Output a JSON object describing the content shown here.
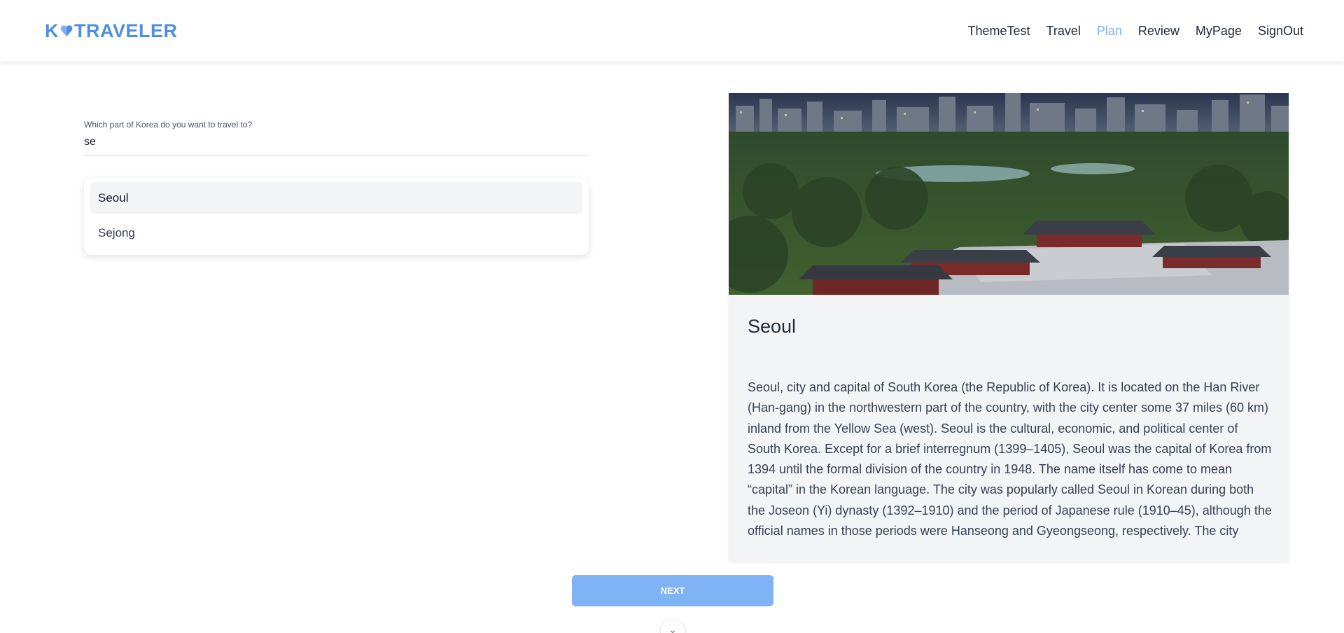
{
  "header": {
    "logo_text_before": "K",
    "logo_text_after": "TRAVELER",
    "brand_color": "#4f8fe0",
    "nav": [
      {
        "label": "ThemeTest",
        "active": false
      },
      {
        "label": "Travel",
        "active": false
      },
      {
        "label": "Plan",
        "active": true
      },
      {
        "label": "Review",
        "active": false
      },
      {
        "label": "MyPage",
        "active": false
      },
      {
        "label": "SignOut",
        "active": false
      }
    ],
    "active_color": "#7fb3f5"
  },
  "search": {
    "label": "Which part of Korea do you want to travel to?",
    "value": "se",
    "suggestions": [
      {
        "label": "Seoul",
        "highlighted": true
      },
      {
        "label": "Sejong",
        "highlighted": false
      }
    ]
  },
  "card": {
    "title": "Seoul",
    "image_icon": "palace-photo",
    "description": "Seoul, city and capital of South Korea (the Republic of Korea). It is located on the Han River (Han-gang) in the northwestern part of the country, with the city center some 37 miles (60 km) inland from the Yellow Sea (west). Seoul is the cultural, economic, and political center of South Korea. Except for a brief interregnum (1399–1405), Seoul was the capital of Korea from 1394 until the formal division of the country in 1948. The name itself has come to mean “capital” in the Korean language. The city was popularly called Seoul in Korean during both the Joseon (Yi) dynasty (1392–1910) and the period of Japanese rule (1910–45), although the official names in those periods were Hanseong and Gyeongseong, respectively. The city"
  },
  "footer": {
    "next_label": "NEXT",
    "scroll_icon": "chevron-down-icon"
  }
}
